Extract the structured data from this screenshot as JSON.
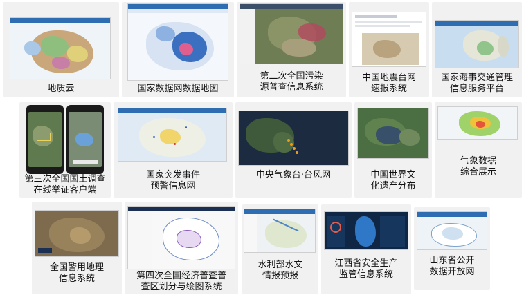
{
  "systems": [
    {
      "label": "地质云"
    },
    {
      "label": "国家数据网数据地图"
    },
    {
      "label": "第二次全国污染\n源普查信息系统"
    },
    {
      "label": "中国地震台网\n速报系统"
    },
    {
      "label": "国家海事交通管理\n信息服务平台"
    },
    {
      "label": "第三次全国国土调查\n在线举证客户端"
    },
    {
      "label": "国家突发事件\n预警信息网"
    },
    {
      "label": "中央气象台·台风网"
    },
    {
      "label": "中国世界文\n化遗产分布"
    },
    {
      "label": "气象数据\n综合展示"
    },
    {
      "label": "全国警用地理\n信息系统"
    },
    {
      "label": "第四次全国经济普查普\n查区划分与绘图系统"
    },
    {
      "label": "水利部水文\n情报预报"
    },
    {
      "label": "江西省安全生产\n监管信息系统"
    },
    {
      "label": "山东省公开\n数据开放网"
    }
  ]
}
